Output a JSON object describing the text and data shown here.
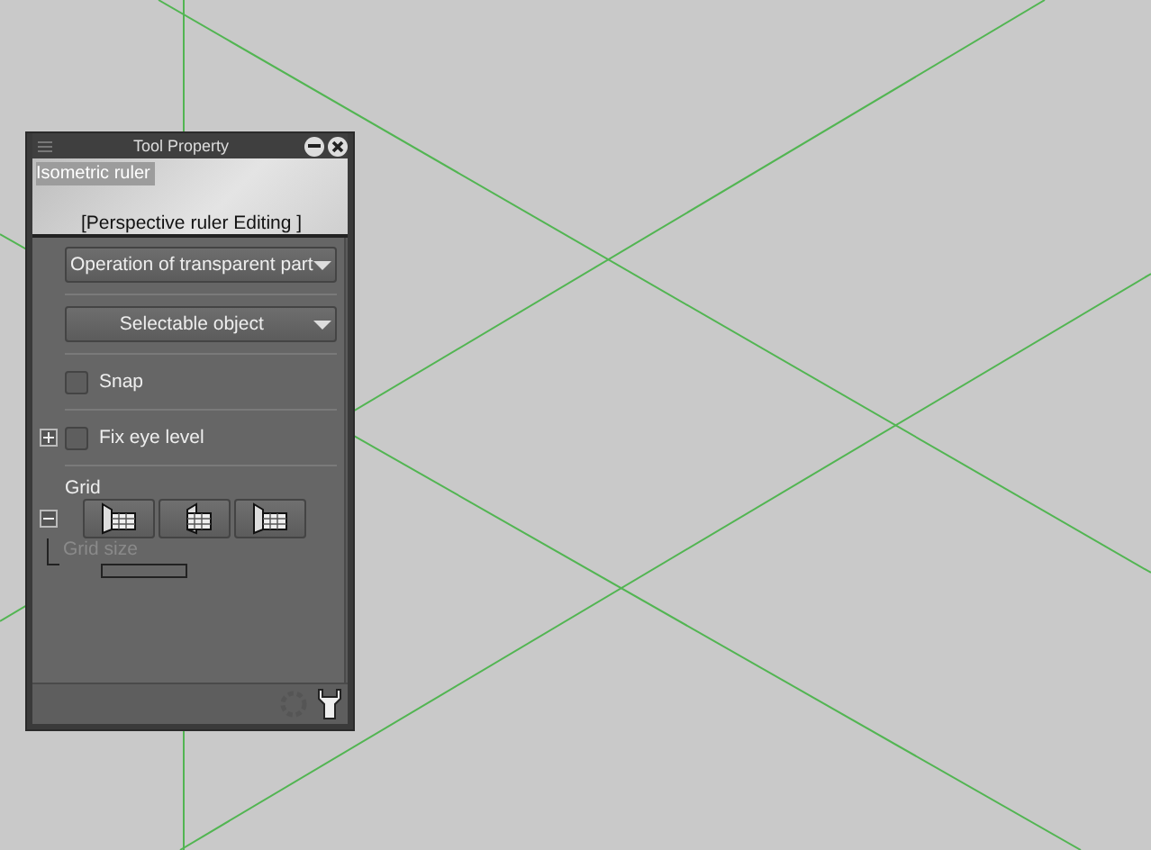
{
  "window": {
    "title": "Tool Property"
  },
  "header": {
    "tool_name": "Isometric ruler",
    "mode": "[Perspective ruler Editing ]"
  },
  "dropdowns": [
    {
      "value": "Operation of transparent part"
    },
    {
      "value": "Selectable object"
    }
  ],
  "options": [
    {
      "label": "Snap",
      "checked": false,
      "expandable": false
    },
    {
      "label": "Fix eye level",
      "checked": false,
      "expandable": true
    }
  ],
  "grid": {
    "label": "Grid",
    "expanded": true,
    "size_label": "Grid size",
    "size_disabled": true
  }
}
